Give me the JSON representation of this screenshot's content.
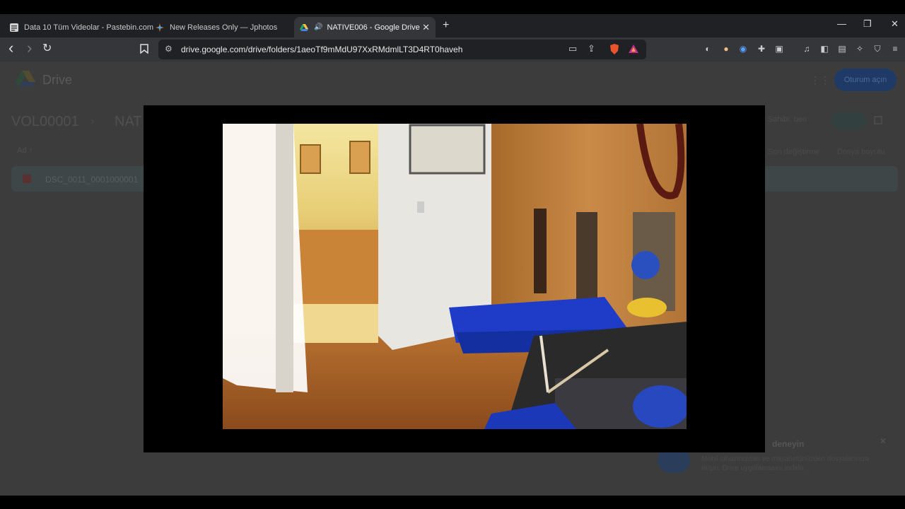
{
  "browser": {
    "tabs": [
      {
        "title": "Data 10 Tüm Videolar - Pastebin.com",
        "favicon": "pastebin-icon",
        "active": false
      },
      {
        "title": "New Releases Only — Jphotos",
        "favicon": "jphotos-icon",
        "active": false
      },
      {
        "title": "NATIVE006 - Google Drive",
        "favicon": "google-drive-icon",
        "active": true,
        "audio": true
      }
    ],
    "new_tab": "+",
    "window_controls": {
      "minimize": "—",
      "maximize": "❐",
      "close": "✕"
    },
    "nav": {
      "back": "‹",
      "forward": "›",
      "reload": "↻"
    },
    "url": "drive.google.com/drive/folders/1aeoTf9mMdU97XxRMdmlLT3D4RT0haveh"
  },
  "drive": {
    "app_name": "Drive",
    "signin_label": "Oturum açın",
    "breadcrumb": [
      "VOL00001",
      "NAT"
    ],
    "column_name": "Ad ↑",
    "owner_label": "Sahibi: ben",
    "modified_label": "Son değiştirme",
    "size_label": "Dosya boyutu",
    "file": {
      "name": "DSC_0011_0001000001"
    },
    "promo": {
      "title": "deneyin",
      "body": "Mobil cihazınızdan ve masaüstünüzden dosyalarınıza erişin. Drive uygulamasını indirin."
    }
  },
  "video": {
    "description_icon": "video-frame"
  },
  "colors": {
    "tabstrip": "#202124",
    "toolbar": "#35363a",
    "page_dimmed": "#3c3c3c",
    "player_bg": "#000000"
  }
}
